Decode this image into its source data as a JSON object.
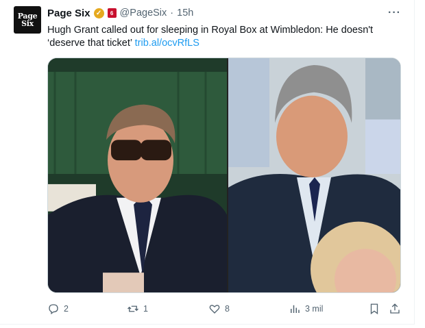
{
  "tweet": {
    "avatar_text_top": "Page",
    "avatar_text_bottom": "Six",
    "name": "Page Six",
    "handle": "@PageSix",
    "separator": "·",
    "time": "15h",
    "affiliate_badge": "6",
    "more_label": "···",
    "text": "Hugh Grant called out for sleeping in Royal Box at Wimbledon: He doesn't ‘deserve that ticket’ ",
    "link": "trib.al/ocvRfLS"
  },
  "media": {
    "left_photo": "photo-left",
    "right_photo": "photo-right"
  },
  "actions": {
    "replies": "2",
    "reposts": "1",
    "likes": "8",
    "views": "3 mil"
  },
  "colors": {
    "accent": "#1d9bf0",
    "muted": "#536471",
    "verified_gold": "#e5a91f",
    "affiliate_red": "#c8102e"
  }
}
